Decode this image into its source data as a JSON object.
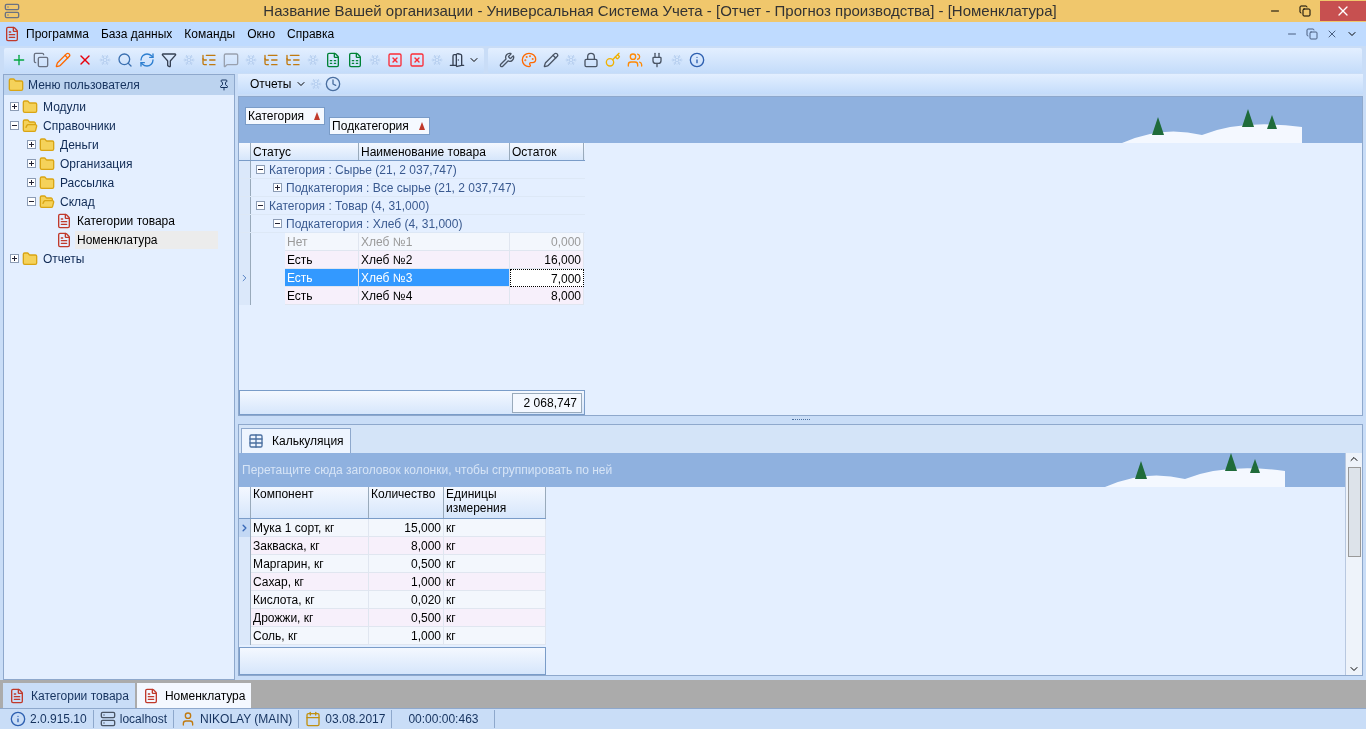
{
  "window": {
    "title": "Название Вашей организации - Универсальная Система Учета - [Отчет - Прогноз производства] - [Номенклатура]"
  },
  "menu": [
    "Программа",
    "База данных",
    "Команды",
    "Окно",
    "Справка"
  ],
  "sidebar": {
    "title": "Меню пользователя",
    "items": [
      {
        "label": "Модули",
        "kind": "folder",
        "expanded": false,
        "selected": false
      },
      {
        "label": "Справочники",
        "kind": "folder",
        "expanded": true,
        "selected": false,
        "children": [
          {
            "label": "Деньги",
            "kind": "folder",
            "expanded": false,
            "selected": false
          },
          {
            "label": "Организация",
            "kind": "folder",
            "expanded": false,
            "selected": false
          },
          {
            "label": "Рассылка",
            "kind": "folder",
            "expanded": false,
            "selected": false
          },
          {
            "label": "Склад",
            "kind": "folder",
            "expanded": true,
            "selected": false,
            "children": [
              {
                "label": "Категории товара",
                "kind": "form",
                "selected": false
              },
              {
                "label": "Номенклатура",
                "kind": "form",
                "selected": true
              }
            ]
          }
        ]
      },
      {
        "label": "Отчеты",
        "kind": "folder",
        "expanded": false,
        "selected": false
      }
    ]
  },
  "report_toolbar": {
    "label": "Отчеты"
  },
  "group_panel": [
    "Категория",
    "Подкатегория"
  ],
  "grid": {
    "columns": [
      "Статус",
      "Наименование товара",
      "Остаток"
    ],
    "groups": [
      {
        "label": "Категория : Сырье (21, 2 037,747)",
        "expanded": true,
        "children": [
          {
            "label": "Подкатегория : Все сырье (21, 2 037,747)",
            "expanded": false
          }
        ]
      },
      {
        "label": "Категория : Товар (4, 31,000)",
        "expanded": true,
        "children": [
          {
            "label": "Подкатегория : Хлеб (4, 31,000)",
            "expanded": true,
            "rows": [
              {
                "cells": [
                  "Нет",
                  "Хлеб №1",
                  "0,000"
                ],
                "disabled": true,
                "selected": false
              },
              {
                "cells": [
                  "Есть",
                  "Хлеб №2",
                  "16,000"
                ],
                "disabled": false,
                "selected": false
              },
              {
                "cells": [
                  "Есть",
                  "Хлеб №3",
                  "7,000"
                ],
                "disabled": false,
                "selected": true
              },
              {
                "cells": [
                  "Есть",
                  "Хлеб №4",
                  "8,000"
                ],
                "disabled": false,
                "selected": false
              }
            ]
          }
        ]
      }
    ],
    "total": "2 068,747"
  },
  "detail": {
    "tab": "Калькуляция",
    "group_hint": "Перетащите сюда заголовок колонки, чтобы сгруппировать по ней",
    "columns": [
      "Компонент",
      "Количество",
      "Единицы измерения"
    ],
    "rows": [
      {
        "cells": [
          "Мука 1 сорт, кг",
          "15,000",
          "кг"
        ],
        "selected": true
      },
      {
        "cells": [
          "Закваска, кг",
          "8,000",
          "кг"
        ],
        "selected": false
      },
      {
        "cells": [
          "Маргарин, кг",
          "0,500",
          "кг"
        ],
        "selected": false
      },
      {
        "cells": [
          "Сахар, кг",
          "1,000",
          "кг"
        ],
        "selected": false
      },
      {
        "cells": [
          "Кислота, кг",
          "0,020",
          "кг"
        ],
        "selected": false
      },
      {
        "cells": [
          "Дрожжи, кг",
          "0,500",
          "кг"
        ],
        "selected": false
      },
      {
        "cells": [
          "Соль, кг",
          "1,000",
          "кг"
        ],
        "selected": false
      }
    ]
  },
  "document_tabs": [
    {
      "label": "Категории товара",
      "selected": false
    },
    {
      "label": "Номенклатура",
      "selected": true
    }
  ],
  "status_bar": [
    {
      "kind": "info",
      "text": "2.0.915.10"
    },
    {
      "kind": "server",
      "text": "localhost"
    },
    {
      "kind": "user",
      "text": "NIKOLAY (MAIN)"
    },
    {
      "kind": "date",
      "text": "03.08.2017"
    },
    {
      "kind": "time",
      "text": "00:00:00:463"
    }
  ]
}
